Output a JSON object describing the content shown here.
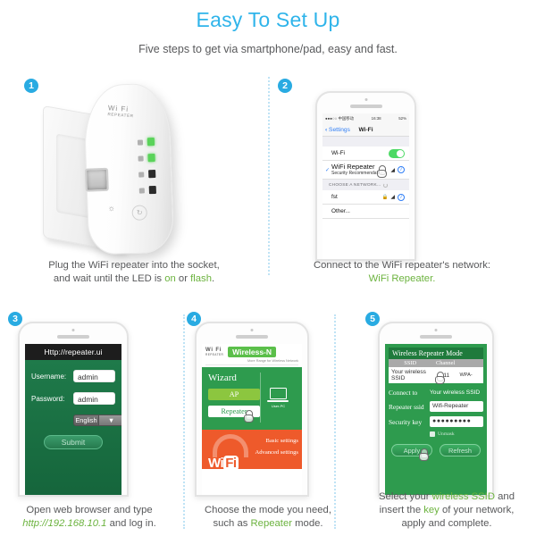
{
  "header": {
    "title": "Easy To Set Up",
    "subtitle": "Five steps to get via smartphone/pad, easy and fast."
  },
  "steps": {
    "one": "1",
    "two": "2",
    "three": "3",
    "four": "4",
    "five": "5"
  },
  "colors": {
    "accent_blue": "#29abe2",
    "accent_green": "#6cb33f",
    "panel_green": "#2e9b4e",
    "panel_orange": "#ee5a2b"
  },
  "step1": {
    "device_logo": "Wi Fi",
    "device_logo_sub": "REPEATER",
    "wps_button": "↻",
    "leds": [
      {
        "name": "power-led",
        "state": "on"
      },
      {
        "name": "wlan-led",
        "state": "on"
      },
      {
        "name": "wps-led",
        "state": "off"
      },
      {
        "name": "lan-led",
        "state": "off"
      }
    ],
    "caption_line1": "Plug the WiFi repeater into the socket,",
    "caption_line2_a": "and wait until the LED is ",
    "caption_line2_on": "on",
    "caption_line2_b": " or ",
    "caption_line2_flash": "flash",
    "caption_line2_c": "."
  },
  "step2": {
    "status_carrier": "●●●○○ 中国移动",
    "status_time": "16:38",
    "status_battery": "52%",
    "nav_back": "Settings",
    "nav_title": "Wi-Fi",
    "wifi_row_label": "Wi-Fi",
    "wifi_toggle_state": "on",
    "connected_network": "WiFi Repeater",
    "connected_subtitle": "Security Recommendation",
    "section_header": "CHOOSE A NETWORK...",
    "network_item": "fst",
    "other_item": "Other...",
    "caption_line1": "Connect to the WiFi repeater's network:",
    "caption_line2": "WiFi Repeater."
  },
  "step3": {
    "url_bar": "Http://repeater.ui",
    "username_label": "Username:",
    "username_value": "admin",
    "password_label": "Password:",
    "password_value": "admin",
    "language_value": "English",
    "submit_label": "Submit",
    "caption_line1": "Open web browser and type",
    "caption_url": "http://192.168.10.1",
    "caption_line2_tail": " and log in."
  },
  "step4": {
    "brand": "Wi Fi",
    "brand_sub": "REPEATER",
    "badge": "Wireless-N",
    "tagline": "More Range for Wireless Network",
    "wizard_title": "Wizard",
    "mode_ap": "AP",
    "mode_repeater": "Repeater",
    "client_label": "User-PC",
    "wifi_logo_a": "Wi",
    "wifi_logo_b": "Fi",
    "link_basic": "Basic settings",
    "link_advanced": "Advanced settings",
    "caption_line1": "Choose the mode you need,",
    "caption_line2_a": "such as ",
    "caption_line2_mode": "Repeater",
    "caption_line2_b": " mode."
  },
  "step5": {
    "panel_title": "Wireless Repeater Mode",
    "table_headers": [
      "SSID",
      "Channel",
      ""
    ],
    "table_row": [
      "Your wireless SSID",
      "11",
      "WPA-"
    ],
    "connect_label": "Connect to",
    "connect_value": "Your wireless SSID",
    "ssid_label": "Repeater ssid",
    "ssid_value": "Wifi-Repeater",
    "key_label": "Security key",
    "key_value": "●●●●●●●●●",
    "unmask_label": "Unmask",
    "apply_label": "Apply",
    "refresh_label": "Refresh",
    "caption_line1_a": "Select your ",
    "caption_line1_ssid": "wireless SSID",
    "caption_line1_b": " and",
    "caption_line2_a": "insert the ",
    "caption_line2_key": "key",
    "caption_line2_b": " of your network,",
    "caption_line3": "apply and complete."
  }
}
